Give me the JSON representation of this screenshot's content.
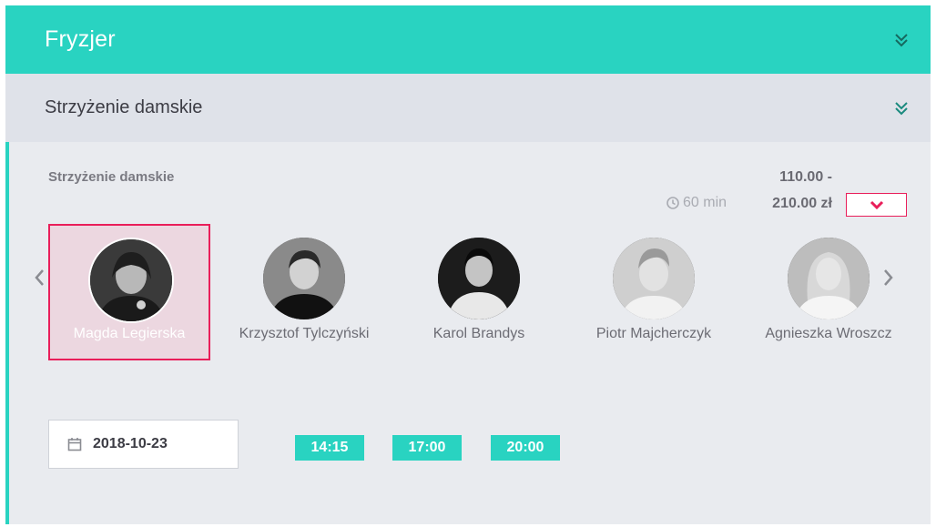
{
  "category": {
    "title": "Fryzjer"
  },
  "service_header": {
    "title": "Strzyżenie damskie"
  },
  "service": {
    "name": "Strzyżenie damskie",
    "price_from": "110.00 -",
    "price_to": "210.00 zł",
    "duration": "60 min"
  },
  "staff": [
    {
      "name": "Magda Legierska",
      "selected": true
    },
    {
      "name": "Krzysztof Tylczyński",
      "selected": false
    },
    {
      "name": "Karol Brandys",
      "selected": false
    },
    {
      "name": "Piotr Majcherczyk",
      "selected": false
    },
    {
      "name": "Agnieszka Wroszcz",
      "selected": false
    }
  ],
  "date": {
    "value": "2018-10-23"
  },
  "time_slots": [
    "14:15",
    "17:00",
    "20:00"
  ],
  "colors": {
    "accent": "#29d3c1",
    "selection": "#e91e5a",
    "header_bg": "#dfe2e9",
    "panel_bg": "#e9ebef"
  },
  "icons": {
    "category_toggle": "double-chevron-down-icon",
    "service_toggle": "double-chevron-down-icon",
    "duration": "clock-icon",
    "expand": "chevron-down-icon",
    "prev": "chevron-left-icon",
    "next": "chevron-right-icon",
    "date": "calendar-icon"
  }
}
